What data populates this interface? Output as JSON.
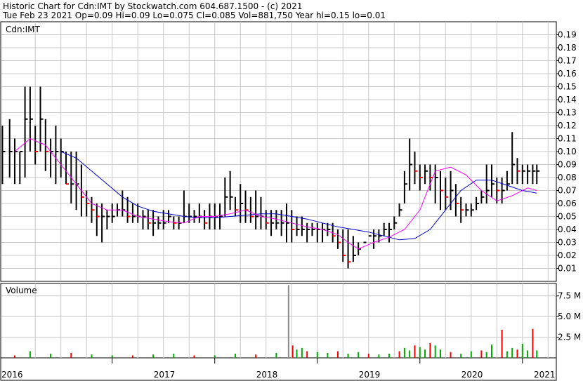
{
  "header": {
    "line1": "Historic Chart for Cdn:IMT by Stockwatch.com 604.687.1500 - (c) 2021",
    "line2": "Tue Feb 23 2021   Op=0.09   Hi=0.09   Lo=0.075   Cl=0.085   Vol=881,750   Year hi=0.15   lo=0.01"
  },
  "chart_data": {
    "type": "line",
    "title": "Historic Chart for Cdn:IMT by Stockwatch.com 604.687.1500 - (c) 2021",
    "symbol": "Cdn:IMT",
    "volume_label": "Volume",
    "price_ylim": [
      0,
      0.2
    ],
    "price_ticks": [
      "0.19",
      "0.18",
      "0.17",
      "0.16",
      "0.15",
      "0.14",
      "0.13",
      "0.12",
      "0.11",
      "0.10",
      "0.09",
      "0.08",
      "0.07",
      "0.06",
      "0.05",
      "0.04",
      "0.03",
      "0.02",
      "0.01"
    ],
    "volume_ylim": [
      0,
      9000000
    ],
    "volume_ticks": [
      "7.5 M",
      "5.0 M",
      "2.5 M"
    ],
    "x_ticks": [
      "2016",
      "2017",
      "2018",
      "2019",
      "2020",
      "2021"
    ],
    "x_range": [
      2015.92,
      2021.33
    ],
    "year_positions": {
      "2016": 0,
      "2017": 1,
      "2018": 2,
      "2019": 3,
      "2020": 4,
      "2021": 5
    },
    "grid": true,
    "colors": {
      "background": "#ffffff",
      "grid": "#c8c8c8",
      "price": "#000000",
      "down": "#ff0000",
      "ma_short": "#ff00ff",
      "ma_long": "#0000cc",
      "vol_up": "#00aa00",
      "vol_down": "#ff0000",
      "vol_spike": "#888888"
    },
    "series": [
      {
        "name": "price",
        "style": "hlc",
        "x": [
          2015.93,
          2016.0,
          2016.05,
          2016.1,
          2016.15,
          2016.2,
          2016.25,
          2016.3,
          2016.35,
          2016.4,
          2016.45,
          2016.5,
          2016.55,
          2016.6,
          2016.65,
          2016.7,
          2016.75,
          2016.8,
          2016.85,
          2016.9,
          2016.95,
          2017.0,
          2017.05,
          2017.1,
          2017.15,
          2017.2,
          2017.25,
          2017.3,
          2017.35,
          2017.4,
          2017.45,
          2017.5,
          2017.55,
          2017.6,
          2017.65,
          2017.7,
          2017.75,
          2017.8,
          2017.85,
          2017.9,
          2017.95,
          2018.0,
          2018.05,
          2018.1,
          2018.15,
          2018.2,
          2018.25,
          2018.3,
          2018.35,
          2018.4,
          2018.45,
          2018.5,
          2018.55,
          2018.6,
          2018.65,
          2018.7,
          2018.75,
          2018.8,
          2018.85,
          2018.9,
          2018.95,
          2019.0,
          2019.05,
          2019.1,
          2019.15,
          2019.2,
          2019.25,
          2019.3,
          2019.35,
          2019.4,
          2019.45,
          2019.5,
          2019.55,
          2019.6,
          2019.65,
          2019.7,
          2019.75,
          2019.8,
          2019.85,
          2019.9,
          2019.95,
          2020.0,
          2020.05,
          2020.1,
          2020.15,
          2020.2,
          2020.25,
          2020.3,
          2020.35,
          2020.4,
          2020.45,
          2020.5,
          2020.55,
          2020.6,
          2020.65,
          2020.7,
          2020.75,
          2020.8,
          2020.85,
          2020.9,
          2020.95,
          2021.0,
          2021.05,
          2021.1,
          2021.14
        ],
        "high": [
          0.12,
          0.125,
          0.11,
          0.1,
          0.15,
          0.15,
          0.12,
          0.15,
          0.125,
          0.11,
          0.12,
          0.11,
          0.1,
          0.1,
          0.1,
          0.09,
          0.07,
          0.065,
          0.06,
          0.06,
          0.055,
          0.06,
          0.06,
          0.07,
          0.065,
          0.06,
          0.06,
          0.055,
          0.055,
          0.055,
          0.05,
          0.055,
          0.055,
          0.05,
          0.05,
          0.07,
          0.06,
          0.055,
          0.06,
          0.055,
          0.06,
          0.06,
          0.06,
          0.08,
          0.085,
          0.065,
          0.075,
          0.07,
          0.065,
          0.07,
          0.065,
          0.055,
          0.055,
          0.055,
          0.055,
          0.06,
          0.055,
          0.05,
          0.05,
          0.045,
          0.045,
          0.045,
          0.045,
          0.045,
          0.045,
          0.04,
          0.04,
          0.04,
          0.035,
          0.03,
          0.02,
          0.025,
          0.04,
          0.04,
          0.045,
          0.045,
          0.05,
          0.06,
          0.085,
          0.11,
          0.1,
          0.09,
          0.09,
          0.09,
          0.09,
          0.085,
          0.08,
          0.085,
          0.075,
          0.065,
          0.06,
          0.06,
          0.065,
          0.07,
          0.09,
          0.09,
          0.08,
          0.08,
          0.085,
          0.115,
          0.095,
          0.09,
          0.09,
          0.09,
          0.09
        ],
        "low": [
          0.075,
          0.08,
          0.075,
          0.075,
          0.08,
          0.1,
          0.09,
          0.1,
          0.085,
          0.08,
          0.075,
          0.08,
          0.075,
          0.06,
          0.055,
          0.05,
          0.05,
          0.045,
          0.035,
          0.03,
          0.04,
          0.045,
          0.05,
          0.05,
          0.045,
          0.045,
          0.045,
          0.04,
          0.04,
          0.035,
          0.04,
          0.04,
          0.045,
          0.04,
          0.04,
          0.045,
          0.045,
          0.045,
          0.045,
          0.04,
          0.04,
          0.04,
          0.04,
          0.05,
          0.055,
          0.05,
          0.045,
          0.045,
          0.045,
          0.04,
          0.04,
          0.04,
          0.035,
          0.04,
          0.035,
          0.03,
          0.03,
          0.035,
          0.035,
          0.03,
          0.035,
          0.03,
          0.03,
          0.035,
          0.03,
          0.025,
          0.015,
          0.01,
          0.015,
          0.02,
          0.02,
          0.025,
          0.025,
          0.03,
          0.035,
          0.03,
          0.04,
          0.05,
          0.06,
          0.07,
          0.075,
          0.07,
          0.075,
          0.07,
          0.06,
          0.055,
          0.055,
          0.055,
          0.05,
          0.045,
          0.05,
          0.05,
          0.055,
          0.06,
          0.06,
          0.065,
          0.06,
          0.06,
          0.07,
          0.075,
          0.075,
          0.075,
          0.075,
          0.075,
          0.075
        ],
        "close": [
          0.1,
          0.1,
          0.1,
          0.1,
          0.125,
          0.125,
          0.1,
          0.125,
          0.1,
          0.1,
          0.1,
          0.1,
          0.075,
          0.075,
          0.075,
          0.065,
          0.06,
          0.055,
          0.05,
          0.05,
          0.05,
          0.05,
          0.055,
          0.055,
          0.05,
          0.05,
          0.05,
          0.05,
          0.045,
          0.045,
          0.045,
          0.045,
          0.05,
          0.045,
          0.045,
          0.05,
          0.05,
          0.05,
          0.05,
          0.045,
          0.05,
          0.05,
          0.05,
          0.065,
          0.065,
          0.055,
          0.06,
          0.055,
          0.05,
          0.05,
          0.05,
          0.045,
          0.045,
          0.045,
          0.045,
          0.045,
          0.04,
          0.04,
          0.04,
          0.04,
          0.04,
          0.04,
          0.04,
          0.04,
          0.035,
          0.03,
          0.02,
          0.015,
          0.02,
          0.025,
          0.03,
          0.035,
          0.035,
          0.035,
          0.04,
          0.04,
          0.045,
          0.055,
          0.075,
          0.09,
          0.085,
          0.08,
          0.085,
          0.08,
          0.08,
          0.07,
          0.065,
          0.07,
          0.06,
          0.055,
          0.055,
          0.055,
          0.06,
          0.065,
          0.07,
          0.075,
          0.07,
          0.07,
          0.075,
          0.09,
          0.085,
          0.085,
          0.085,
          0.085,
          0.085
        ]
      },
      {
        "name": "MA-short",
        "x": [
          2016.05,
          2016.2,
          2016.35,
          2016.5,
          2016.65,
          2016.8,
          2016.95,
          2017.1,
          2017.25,
          2017.4,
          2017.55,
          2017.7,
          2017.85,
          2018.0,
          2018.15,
          2018.3,
          2018.45,
          2018.6,
          2018.75,
          2018.9,
          2019.05,
          2019.2,
          2019.3,
          2019.4,
          2019.55,
          2019.7,
          2019.85,
          2020.0,
          2020.15,
          2020.3,
          2020.45,
          2020.6,
          2020.75,
          2020.9,
          2021.05,
          2021.14
        ],
        "values": [
          0.1,
          0.11,
          0.105,
          0.09,
          0.075,
          0.06,
          0.055,
          0.055,
          0.05,
          0.048,
          0.046,
          0.045,
          0.05,
          0.05,
          0.052,
          0.055,
          0.05,
          0.048,
          0.045,
          0.042,
          0.04,
          0.036,
          0.03,
          0.025,
          0.03,
          0.034,
          0.04,
          0.055,
          0.085,
          0.088,
          0.082,
          0.07,
          0.062,
          0.066,
          0.072,
          0.07
        ]
      },
      {
        "name": "MA-long",
        "x": [
          2016.5,
          2016.65,
          2016.8,
          2016.95,
          2017.1,
          2017.25,
          2017.4,
          2017.55,
          2017.7,
          2017.85,
          2018.0,
          2018.15,
          2018.3,
          2018.45,
          2018.6,
          2018.75,
          2018.9,
          2019.05,
          2019.2,
          2019.35,
          2019.5,
          2019.65,
          2019.8,
          2019.95,
          2020.1,
          2020.25,
          2020.4,
          2020.55,
          2020.7,
          2020.85,
          2021.0,
          2021.14
        ],
        "values": [
          0.1,
          0.095,
          0.085,
          0.075,
          0.065,
          0.058,
          0.054,
          0.052,
          0.05,
          0.049,
          0.049,
          0.05,
          0.051,
          0.052,
          0.052,
          0.05,
          0.048,
          0.045,
          0.042,
          0.04,
          0.038,
          0.035,
          0.032,
          0.033,
          0.04,
          0.055,
          0.07,
          0.078,
          0.078,
          0.074,
          0.07,
          0.068
        ]
      },
      {
        "name": "Volume",
        "x": [
          2016.05,
          2016.2,
          2016.4,
          2016.6,
          2016.8,
          2017.0,
          2017.2,
          2017.4,
          2017.6,
          2017.8,
          2018.0,
          2018.2,
          2018.4,
          2018.6,
          2018.72,
          2018.76,
          2018.8,
          2018.85,
          2018.9,
          2019.0,
          2019.1,
          2019.2,
          2019.3,
          2019.4,
          2019.5,
          2019.6,
          2019.7,
          2019.8,
          2019.85,
          2019.9,
          2019.95,
          2020.0,
          2020.05,
          2020.1,
          2020.15,
          2020.2,
          2020.3,
          2020.4,
          2020.5,
          2020.6,
          2020.65,
          2020.7,
          2020.8,
          2020.85,
          2020.9,
          2020.95,
          2021.0,
          2021.05,
          2021.1,
          2021.14
        ],
        "values": [
          300000,
          800000,
          500000,
          600000,
          400000,
          300000,
          300000,
          400000,
          500000,
          300000,
          300000,
          500000,
          400000,
          600000,
          8800000,
          1500000,
          1000000,
          1200000,
          800000,
          700000,
          600000,
          800000,
          500000,
          700000,
          500000,
          400000,
          500000,
          800000,
          1200000,
          900000,
          1500000,
          1300000,
          1000000,
          1800000,
          1500000,
          1000000,
          700000,
          500000,
          800000,
          900000,
          700000,
          1600000,
          3400000,
          800000,
          1200000,
          1000000,
          1700000,
          900000,
          3500000,
          900000
        ]
      }
    ]
  }
}
